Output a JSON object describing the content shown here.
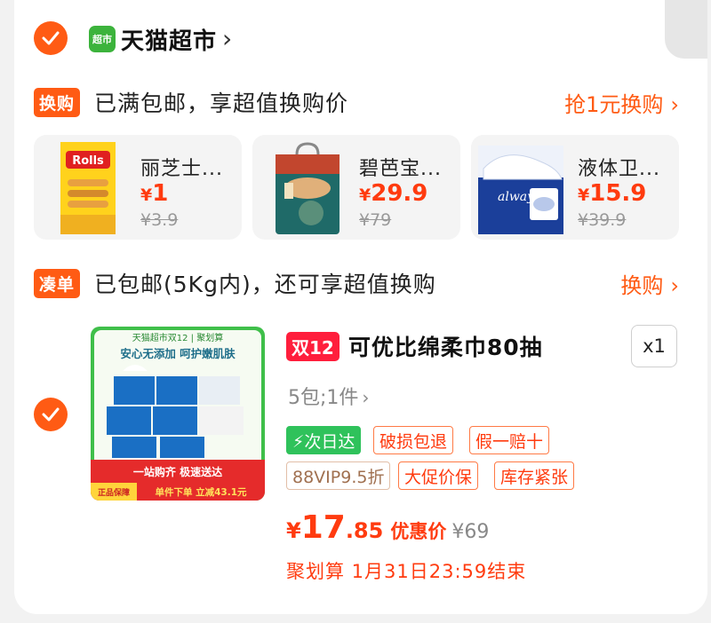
{
  "store": {
    "logo_text": "超市",
    "name": "天猫超市",
    "chevron": "›"
  },
  "exchange": {
    "tag": "换购",
    "message": "已满包邮，享超值换购价",
    "link": "抢1元换购",
    "chevron": "›",
    "items": [
      {
        "name": "丽芝士...",
        "currency": "¥",
        "price": "1",
        "original": "¥3.9",
        "image_brand": "Rolls"
      },
      {
        "name": "碧芭宝...",
        "currency": "¥",
        "price": "29.9",
        "original": "¥79"
      },
      {
        "name": "液体卫...",
        "currency": "¥",
        "price": "15.9",
        "original": "¥39.9",
        "image_brand": "always"
      }
    ]
  },
  "combine": {
    "tag": "凑单",
    "message": "已包邮(5Kg内)，还可享超值换购",
    "link": "换购",
    "chevron": "›"
  },
  "product": {
    "image_banner": "天猫超市双12 | 聚划算",
    "image_slogan": "安心无添加 呵护嫩肌肤",
    "image_footer1": "一站购齐 极速送达",
    "image_badge": "正品保障",
    "image_footer2": "单件下单 立减43.1元",
    "badge": "双12",
    "title": "可优比绵柔巾80抽",
    "quantity": "x1",
    "spec": "5包;1件",
    "spec_chevron": "›",
    "tags": [
      {
        "label": "⚡次日达",
        "style": "green"
      },
      {
        "label": "破损包退",
        "style": "orange"
      },
      {
        "label": "假一赔十",
        "style": "orange"
      },
      {
        "label": "88VIP9.5折",
        "style": "vip"
      },
      {
        "label": "大促价保",
        "style": "orange"
      },
      {
        "label": "库存紧张",
        "style": "orange"
      }
    ],
    "price_currency": "¥",
    "price_int": "17",
    "price_dec": ".85",
    "price_label": "优惠价",
    "original_price": "¥69",
    "deadline": "聚划算 1月31日23:59结束"
  },
  "colors": {
    "accent": "#ff5b14",
    "price": "#ff3b0f",
    "green": "#2fc25b",
    "badge_red": "#ff1e3c"
  }
}
